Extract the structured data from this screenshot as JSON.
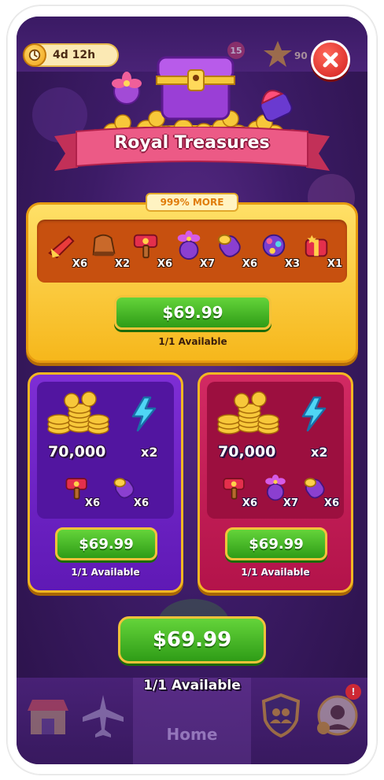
{
  "hud": {
    "timer": "4d 12h",
    "badge_count": "15",
    "stars": "90"
  },
  "title": "Royal Treasures",
  "main_offer": {
    "tag": "999% MORE",
    "items": [
      {
        "icon": "rocket-booster-icon",
        "qty": "X6"
      },
      {
        "icon": "boot-booster-icon",
        "qty": "X2"
      },
      {
        "icon": "hammer-booster-icon",
        "qty": "X6"
      },
      {
        "icon": "flower-bomb-icon",
        "qty": "X7"
      },
      {
        "icon": "cannon-booster-icon",
        "qty": "X6"
      },
      {
        "icon": "orb-bomb-icon",
        "qty": "X3"
      },
      {
        "icon": "gift-box-icon",
        "qty": "X1"
      }
    ],
    "price": "$69.99",
    "availability": "1/1 Available"
  },
  "side_offers": [
    {
      "theme": "purple",
      "coins": "70,000",
      "bolt_qty": "x2",
      "items": [
        {
          "icon": "hammer-booster-icon",
          "qty": "X6"
        },
        {
          "icon": "cannon-booster-icon",
          "qty": "X6"
        }
      ],
      "price": "$69.99",
      "availability": "1/1 Available"
    },
    {
      "theme": "pink",
      "coins": "70,000",
      "bolt_qty": "x2",
      "items": [
        {
          "icon": "hammer-booster-icon",
          "qty": "X6"
        },
        {
          "icon": "flower-bomb-icon",
          "qty": "X7"
        },
        {
          "icon": "cannon-booster-icon",
          "qty": "X6"
        }
      ],
      "price": "$69.99",
      "availability": "1/1 Available"
    }
  ],
  "bottom_offer": {
    "price": "$69.99",
    "availability": "1/1 Available"
  },
  "navbar": {
    "home_label": "Home",
    "notification": "!"
  },
  "colors": {
    "background": "#3c1b66",
    "gold": "#f6b71b",
    "green_button": "#2f9c17",
    "ribbon": "#e24d7a",
    "close_button": "#d21d1d"
  }
}
